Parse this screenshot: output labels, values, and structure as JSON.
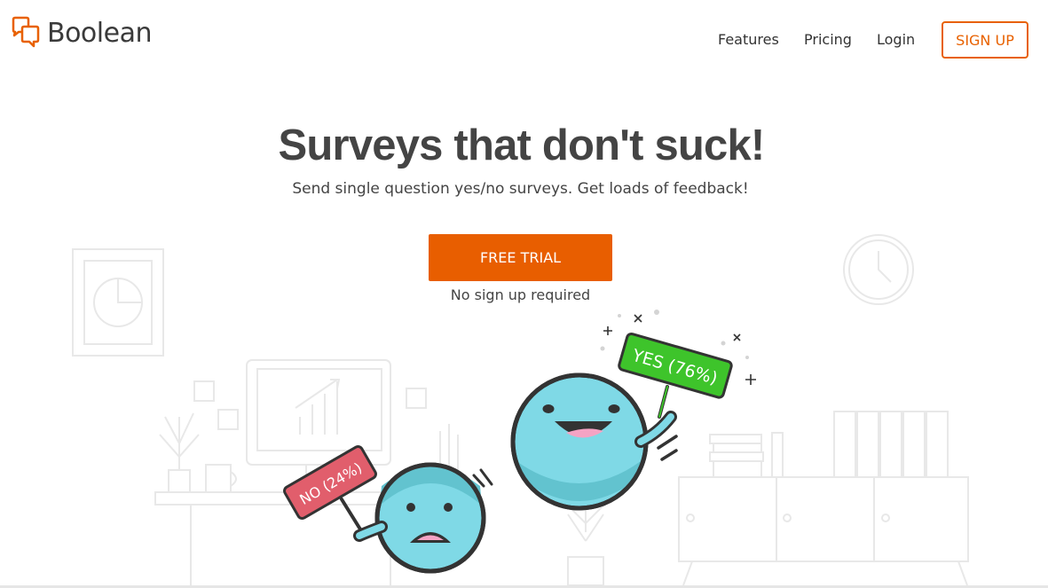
{
  "brand": {
    "name": "Boolean",
    "accent": "#e86100",
    "text_color": "#444444"
  },
  "nav": {
    "features": "Features",
    "pricing": "Pricing",
    "login": "Login",
    "signup": "SIGN UP"
  },
  "hero": {
    "title": "Surveys that don't suck!",
    "subtitle": "Send single question yes/no surveys. Get loads of feedback!",
    "cta": "FREE TRIAL",
    "cta_note": "No sign up required"
  },
  "illustration": {
    "yes_sign": "YES (76%)",
    "no_sign": "NO (24%)",
    "yes_color": "#3ec42b",
    "no_color": "#e15e6c",
    "character_color": "#7fd9e6"
  }
}
